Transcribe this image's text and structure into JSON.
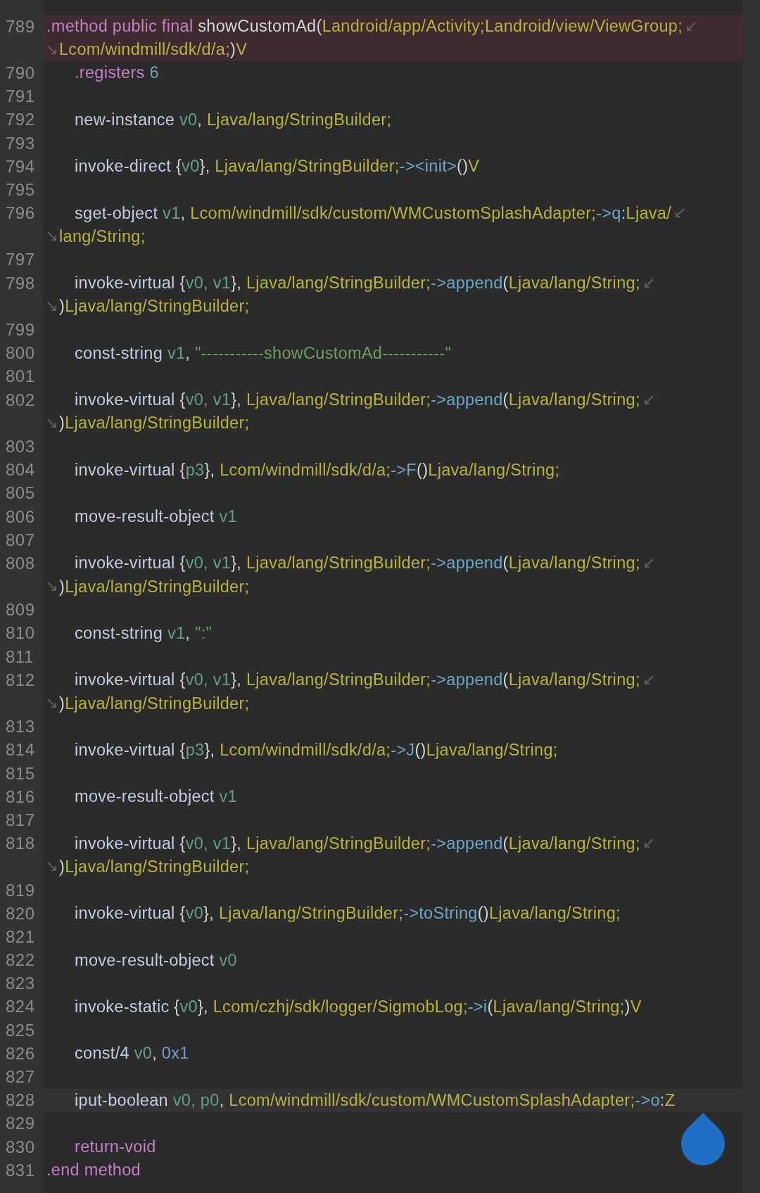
{
  "lines": [
    {
      "number": "789",
      "breakpoint": true,
      "current": false,
      "tokens": [
        {
          "kind": "dir",
          "text": ".method public final "
        },
        {
          "kind": "name",
          "text": "showCustomAd"
        },
        {
          "kind": "punct",
          "text": "("
        },
        {
          "kind": "type",
          "text": "Landroid/app/Activity;Landroid/view/ViewGroup;"
        }
      ],
      "continuation": [
        {
          "kind": "type",
          "text": "Lcom/windmill/sdk/d/a;"
        },
        {
          "kind": "punct",
          "text": ")"
        },
        {
          "kind": "type",
          "text": "V"
        }
      ],
      "children": [
        {
          "number": "790",
          "breakpoint": false,
          "current": false,
          "tokens": [
            {
              "kind": "dir",
              "text": ".registers "
            },
            {
              "kind": "num",
              "text": "6"
            }
          ]
        },
        {
          "number": "791",
          "breakpoint": false,
          "current": false
        },
        {
          "number": "792",
          "breakpoint": false,
          "current": false,
          "tokens": [
            {
              "kind": "op",
              "text": "new-instance "
            },
            {
              "kind": "reg",
              "text": "v0"
            },
            {
              "kind": "punct",
              "text": ", "
            },
            {
              "kind": "type",
              "text": "Ljava/lang/StringBuilder;"
            }
          ]
        },
        {
          "number": "793",
          "breakpoint": false,
          "current": false
        },
        {
          "number": "794",
          "breakpoint": false,
          "current": false,
          "tokens": [
            {
              "kind": "op",
              "text": "invoke-direct "
            },
            {
              "kind": "punct",
              "text": "{"
            },
            {
              "kind": "reg",
              "text": "v0"
            },
            {
              "kind": "punct",
              "text": "}, "
            },
            {
              "kind": "type",
              "text": "Ljava/lang/StringBuilder;"
            },
            {
              "kind": "ref",
              "text": "-><init>"
            },
            {
              "kind": "punct",
              "text": "()"
            },
            {
              "kind": "type",
              "text": "V"
            }
          ]
        },
        {
          "number": "795",
          "breakpoint": false,
          "current": false
        },
        {
          "number": "796",
          "breakpoint": false,
          "current": false,
          "tokens": [
            {
              "kind": "op",
              "text": "sget-object "
            },
            {
              "kind": "reg",
              "text": "v1"
            },
            {
              "kind": "punct",
              "text": ", "
            },
            {
              "kind": "type",
              "text": "Lcom/windmill/sdk/custom/WMCustomSplashAdapter;"
            },
            {
              "kind": "ref",
              "text": "->q"
            },
            {
              "kind": "punct",
              "text": ":"
            },
            {
              "kind": "type",
              "text": "Ljava/"
            }
          ],
          "continuation": [
            {
              "kind": "type",
              "text": "lang/String;"
            }
          ]
        },
        {
          "number": "797",
          "breakpoint": false,
          "current": false
        },
        {
          "number": "798",
          "breakpoint": false,
          "current": false,
          "tokens": [
            {
              "kind": "op",
              "text": "invoke-virtual "
            },
            {
              "kind": "punct",
              "text": "{"
            },
            {
              "kind": "reg",
              "text": "v0, v1"
            },
            {
              "kind": "punct",
              "text": "}, "
            },
            {
              "kind": "type",
              "text": "Ljava/lang/StringBuilder;"
            },
            {
              "kind": "ref",
              "text": "->append"
            },
            {
              "kind": "punct",
              "text": "("
            },
            {
              "kind": "type",
              "text": "Ljava/lang/String;"
            }
          ],
          "continuation": [
            {
              "kind": "punct",
              "text": ")"
            },
            {
              "kind": "type",
              "text": "Ljava/lang/StringBuilder;"
            }
          ]
        },
        {
          "number": "799",
          "breakpoint": false,
          "current": false
        },
        {
          "number": "800",
          "breakpoint": false,
          "current": false,
          "tokens": [
            {
              "kind": "op",
              "text": "const-string "
            },
            {
              "kind": "reg",
              "text": "v1"
            },
            {
              "kind": "punct",
              "text": ", "
            },
            {
              "kind": "str",
              "text": "\"-----------showCustomAd-----------\""
            }
          ]
        },
        {
          "number": "801",
          "breakpoint": false,
          "current": false
        },
        {
          "number": "802",
          "breakpoint": false,
          "current": false,
          "tokens": [
            {
              "kind": "op",
              "text": "invoke-virtual "
            },
            {
              "kind": "punct",
              "text": "{"
            },
            {
              "kind": "reg",
              "text": "v0, v1"
            },
            {
              "kind": "punct",
              "text": "}, "
            },
            {
              "kind": "type",
              "text": "Ljava/lang/StringBuilder;"
            },
            {
              "kind": "ref",
              "text": "->append"
            },
            {
              "kind": "punct",
              "text": "("
            },
            {
              "kind": "type",
              "text": "Ljava/lang/String;"
            }
          ],
          "continuation": [
            {
              "kind": "punct",
              "text": ")"
            },
            {
              "kind": "type",
              "text": "Ljava/lang/StringBuilder;"
            }
          ]
        },
        {
          "number": "803",
          "breakpoint": false,
          "current": false
        },
        {
          "number": "804",
          "breakpoint": false,
          "current": false,
          "tokens": [
            {
              "kind": "op",
              "text": "invoke-virtual "
            },
            {
              "kind": "punct",
              "text": "{"
            },
            {
              "kind": "reg",
              "text": "p3"
            },
            {
              "kind": "punct",
              "text": "}, "
            },
            {
              "kind": "type",
              "text": "Lcom/windmill/sdk/d/a;"
            },
            {
              "kind": "ref",
              "text": "->F"
            },
            {
              "kind": "punct",
              "text": "()"
            },
            {
              "kind": "type",
              "text": "Ljava/lang/String;"
            }
          ]
        },
        {
          "number": "805",
          "breakpoint": false,
          "current": false
        },
        {
          "number": "806",
          "breakpoint": false,
          "current": false,
          "tokens": [
            {
              "kind": "op",
              "text": "move-result-object "
            },
            {
              "kind": "reg",
              "text": "v1"
            }
          ]
        },
        {
          "number": "807",
          "breakpoint": false,
          "current": false
        },
        {
          "number": "808",
          "breakpoint": false,
          "current": false,
          "tokens": [
            {
              "kind": "op",
              "text": "invoke-virtual "
            },
            {
              "kind": "punct",
              "text": "{"
            },
            {
              "kind": "reg",
              "text": "v0, v1"
            },
            {
              "kind": "punct",
              "text": "}, "
            },
            {
              "kind": "type",
              "text": "Ljava/lang/StringBuilder;"
            },
            {
              "kind": "ref",
              "text": "->append"
            },
            {
              "kind": "punct",
              "text": "("
            },
            {
              "kind": "type",
              "text": "Ljava/lang/String;"
            }
          ],
          "continuation": [
            {
              "kind": "punct",
              "text": ")"
            },
            {
              "kind": "type",
              "text": "Ljava/lang/StringBuilder;"
            }
          ]
        },
        {
          "number": "809",
          "breakpoint": false,
          "current": false
        },
        {
          "number": "810",
          "breakpoint": false,
          "current": false,
          "tokens": [
            {
              "kind": "op",
              "text": "const-string "
            },
            {
              "kind": "reg",
              "text": "v1"
            },
            {
              "kind": "punct",
              "text": ", "
            },
            {
              "kind": "str",
              "text": "\":\""
            }
          ]
        },
        {
          "number": "811",
          "breakpoint": false,
          "current": false
        },
        {
          "number": "812",
          "breakpoint": false,
          "current": false,
          "tokens": [
            {
              "kind": "op",
              "text": "invoke-virtual "
            },
            {
              "kind": "punct",
              "text": "{"
            },
            {
              "kind": "reg",
              "text": "v0, v1"
            },
            {
              "kind": "punct",
              "text": "}, "
            },
            {
              "kind": "type",
              "text": "Ljava/lang/StringBuilder;"
            },
            {
              "kind": "ref",
              "text": "->append"
            },
            {
              "kind": "punct",
              "text": "("
            },
            {
              "kind": "type",
              "text": "Ljava/lang/String;"
            }
          ],
          "continuation": [
            {
              "kind": "punct",
              "text": ")"
            },
            {
              "kind": "type",
              "text": "Ljava/lang/StringBuilder;"
            }
          ]
        },
        {
          "number": "813",
          "breakpoint": false,
          "current": false
        },
        {
          "number": "814",
          "breakpoint": false,
          "current": false,
          "tokens": [
            {
              "kind": "op",
              "text": "invoke-virtual "
            },
            {
              "kind": "punct",
              "text": "{"
            },
            {
              "kind": "reg",
              "text": "p3"
            },
            {
              "kind": "punct",
              "text": "}, "
            },
            {
              "kind": "type",
              "text": "Lcom/windmill/sdk/d/a;"
            },
            {
              "kind": "ref",
              "text": "->J"
            },
            {
              "kind": "punct",
              "text": "()"
            },
            {
              "kind": "type",
              "text": "Ljava/lang/String;"
            }
          ]
        },
        {
          "number": "815",
          "breakpoint": false,
          "current": false
        },
        {
          "number": "816",
          "breakpoint": false,
          "current": false,
          "tokens": [
            {
              "kind": "op",
              "text": "move-result-object "
            },
            {
              "kind": "reg",
              "text": "v1"
            }
          ]
        },
        {
          "number": "817",
          "breakpoint": false,
          "current": false
        },
        {
          "number": "818",
          "breakpoint": false,
          "current": false,
          "tokens": [
            {
              "kind": "op",
              "text": "invoke-virtual "
            },
            {
              "kind": "punct",
              "text": "{"
            },
            {
              "kind": "reg",
              "text": "v0, v1"
            },
            {
              "kind": "punct",
              "text": "}, "
            },
            {
              "kind": "type",
              "text": "Ljava/lang/StringBuilder;"
            },
            {
              "kind": "ref",
              "text": "->append"
            },
            {
              "kind": "punct",
              "text": "("
            },
            {
              "kind": "type",
              "text": "Ljava/lang/String;"
            }
          ],
          "continuation": [
            {
              "kind": "punct",
              "text": ")"
            },
            {
              "kind": "type",
              "text": "Ljava/lang/StringBuilder;"
            }
          ]
        },
        {
          "number": "819",
          "breakpoint": false,
          "current": false
        },
        {
          "number": "820",
          "breakpoint": false,
          "current": false,
          "tokens": [
            {
              "kind": "op",
              "text": "invoke-virtual "
            },
            {
              "kind": "punct",
              "text": "{"
            },
            {
              "kind": "reg",
              "text": "v0"
            },
            {
              "kind": "punct",
              "text": "}, "
            },
            {
              "kind": "type",
              "text": "Ljava/lang/StringBuilder;"
            },
            {
              "kind": "ref",
              "text": "->toString"
            },
            {
              "kind": "punct",
              "text": "()"
            },
            {
              "kind": "type",
              "text": "Ljava/lang/String;"
            }
          ]
        },
        {
          "number": "821",
          "breakpoint": false,
          "current": false
        },
        {
          "number": "822",
          "breakpoint": false,
          "current": false,
          "tokens": [
            {
              "kind": "op",
              "text": "move-result-object "
            },
            {
              "kind": "reg",
              "text": "v0"
            }
          ]
        },
        {
          "number": "823",
          "breakpoint": false,
          "current": false
        },
        {
          "number": "824",
          "breakpoint": false,
          "current": false,
          "tokens": [
            {
              "kind": "op",
              "text": "invoke-static "
            },
            {
              "kind": "punct",
              "text": "{"
            },
            {
              "kind": "reg",
              "text": "v0"
            },
            {
              "kind": "punct",
              "text": "}, "
            },
            {
              "kind": "type",
              "text": "Lcom/czhj/sdk/logger/SigmobLog;"
            },
            {
              "kind": "ref",
              "text": "->i"
            },
            {
              "kind": "punct",
              "text": "("
            },
            {
              "kind": "type",
              "text": "Ljava/lang/String;"
            },
            {
              "kind": "punct",
              "text": ")"
            },
            {
              "kind": "type",
              "text": "V"
            }
          ]
        },
        {
          "number": "825",
          "breakpoint": false,
          "current": false
        },
        {
          "number": "826",
          "breakpoint": false,
          "current": false,
          "tokens": [
            {
              "kind": "op",
              "text": "const/4 "
            },
            {
              "kind": "reg",
              "text": "v0"
            },
            {
              "kind": "punct",
              "text": ", "
            },
            {
              "kind": "num",
              "text": "0x1"
            }
          ]
        },
        {
          "number": "827",
          "breakpoint": false,
          "current": false
        },
        {
          "number": "828",
          "breakpoint": false,
          "current": true,
          "tokens": [
            {
              "kind": "op",
              "text": "iput-boolean "
            },
            {
              "kind": "reg",
              "text": "v0, p0"
            },
            {
              "kind": "punct",
              "text": ", "
            },
            {
              "kind": "type",
              "text": "Lcom/windmill/sdk/custom/WMCustomSplashAdapter;"
            },
            {
              "kind": "ref",
              "text": "->o"
            },
            {
              "kind": "punct",
              "text": ":"
            },
            {
              "kind": "type",
              "text": "Z"
            }
          ]
        },
        {
          "number": "829",
          "breakpoint": false,
          "current": false
        },
        {
          "number": "830",
          "breakpoint": false,
          "current": false,
          "tokens": [
            {
              "kind": "dir",
              "text": "return-void"
            }
          ]
        }
      ]
    },
    {
      "number": "831",
      "breakpoint": false,
      "current": false,
      "tokens": [
        {
          "kind": "dir",
          "text": ".end method"
        }
      ]
    }
  ]
}
